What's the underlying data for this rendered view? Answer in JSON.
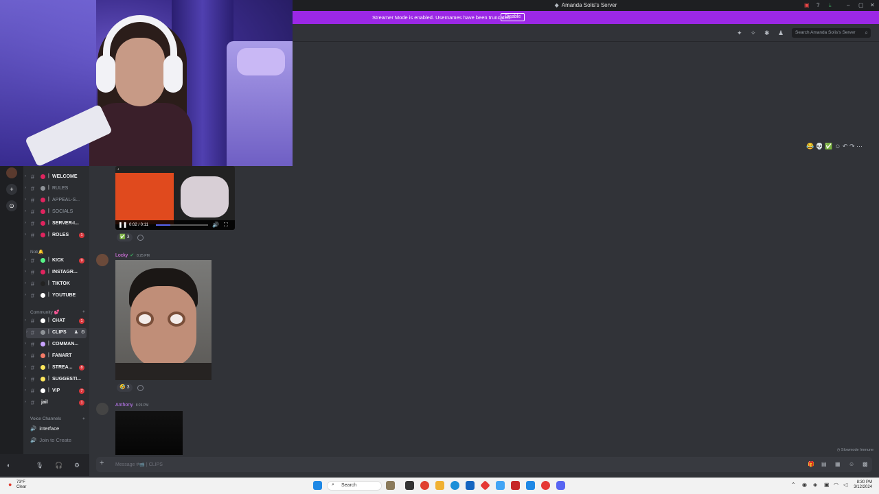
{
  "window": {
    "title": "Amanda Solis's Server",
    "controls": [
      "–",
      "▢",
      "✕"
    ]
  },
  "banner": {
    "text": "Streamer Mode is enabled. Usernames have been truncated.",
    "button_label": "Disable",
    "color": "#9b28e6"
  },
  "header": {
    "search_placeholder": "Search Amanda Solis's Server"
  },
  "sidebar": {
    "channels": [
      {
        "name": "WELCOME",
        "dim": false,
        "color": "#e0245e",
        "badge": ""
      },
      {
        "name": "RULES",
        "dim": true,
        "color": "#8e9297",
        "badge": ""
      },
      {
        "name": "APPEAL-S...",
        "dim": true,
        "color": "#e0245e",
        "badge": ""
      },
      {
        "name": "SOCIALS",
        "dim": true,
        "color": "#e0245e",
        "badge": ""
      },
      {
        "name": "SERVER-I...",
        "dim": false,
        "color": "#e0245e",
        "badge": ""
      },
      {
        "name": "ROLES",
        "dim": false,
        "color": "#e0245e",
        "badge": "1"
      }
    ],
    "notif_category": "Noti🔔",
    "notif_channels": [
      {
        "name": "KICK",
        "dim": false,
        "color": "#57f287",
        "badge": "9"
      },
      {
        "name": "INSTAGR...",
        "dim": false,
        "color": "#e0245e",
        "badge": ""
      },
      {
        "name": "TIKTOK",
        "dim": false,
        "color": "#222222",
        "badge": ""
      },
      {
        "name": "YOUTUBE",
        "dim": false,
        "color": "#ffffff",
        "badge": ""
      }
    ],
    "community_category": "Community 💕",
    "community_channels": [
      {
        "name": "CHAT",
        "dim": false,
        "color": "#ffffff",
        "badge": "1",
        "active": false
      },
      {
        "name": "CLIPS",
        "dim": false,
        "color": "#8e9297",
        "badge": "",
        "active": true
      },
      {
        "name": "COMMAN...",
        "dim": false,
        "color": "#c9a3ff",
        "badge": "",
        "active": false
      },
      {
        "name": "FANART",
        "dim": false,
        "color": "#f47b67",
        "badge": "",
        "active": false
      },
      {
        "name": "STREA...",
        "dim": false,
        "color": "#fee75c",
        "badge": "8",
        "active": false
      },
      {
        "name": "SUGGESTI...",
        "dim": false,
        "color": "#fee75c",
        "badge": "",
        "active": false
      },
      {
        "name": "VIP",
        "dim": false,
        "color": "#ffffff",
        "badge": "7",
        "active": false
      },
      {
        "name": "jail",
        "dim": false,
        "color": "",
        "badge": "1",
        "active": false
      }
    ],
    "voice_category": "Voice Channels",
    "voice_channels": [
      "interface",
      "Join to Create"
    ]
  },
  "messages": [
    {
      "author": "",
      "reaction": "✅",
      "reaction_count": "3",
      "video_time": "0:02 / 0:11",
      "progress": 0.28
    },
    {
      "author": "Locky",
      "author_color": "#f47fff",
      "timestamp": "8:25 PM",
      "reaction": "🤣",
      "reaction_count": "3"
    },
    {
      "author": "Anthony",
      "author_color": "#c77dff",
      "timestamp": "8:26 PM"
    }
  ],
  "composer": {
    "placeholder": "Message #📹 | CLIPS"
  },
  "slowmode_text": "Slowmode Immune",
  "taskbar": {
    "weather_temp": "73°F",
    "weather_text": "Clear",
    "search_label": "Search",
    "time": "8:30 PM",
    "date": "3/12/2024"
  }
}
